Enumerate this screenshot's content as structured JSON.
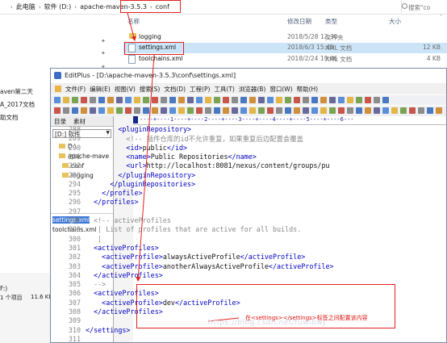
{
  "explorer": {
    "breadcrumb": [
      "此电脑",
      "软件 (D:)",
      "apache-maven-3.5.3",
      "conf"
    ],
    "search_placeholder": "搜索\"co",
    "columns": {
      "name": "名称",
      "date": "修改日期",
      "type": "类型",
      "size": "大小"
    },
    "files": [
      {
        "name": "logging",
        "date": "2018/5/28 12:30",
        "type": "文件夹",
        "size": ""
      },
      {
        "name": "settings.xml",
        "date": "2018/6/3 15:45",
        "type": "XML 文档",
        "size": "12 KB"
      },
      {
        "name": "toolchains.xml",
        "date": "2018/2/24 19:46",
        "type": "XML 文档",
        "size": "4 KB"
      }
    ],
    "left_nav": [
      "aven第二天",
      "A_2017文档",
      "助文档"
    ],
    "status": {
      "drive": "F:)",
      "count": "1 个项目",
      "size": "11.6 KB"
    }
  },
  "editplus": {
    "title": "EditPlus - [D:\\apache-maven-3.5.3\\conf\\settings.xml]",
    "menu": [
      "文件(F)",
      "编辑(E)",
      "视图(V)",
      "搜索(S)",
      "文档(D)",
      "工程(P)",
      "工具(T)",
      "浏览器(B)",
      "窗口(W)",
      "帮助(H)"
    ],
    "tabs": [
      "目录",
      "素材"
    ],
    "drive": "[D:] 软件",
    "tree": [
      "D:\\",
      "apache-mave",
      "conf",
      "logging"
    ],
    "files": [
      "settings.xml",
      "toolchains.xml"
    ],
    "ruler": "----+----1----+----2----+----3----+----4----+----5----+----6---",
    "lines": [
      {
        "n": "288",
        "segs": [
          [
            "t",
            "        <pluginRepository>"
          ]
        ]
      },
      {
        "n": "289",
        "segs": [
          [
            "c",
            "          <!-- 插件仓库的id不允许重复，如果重复后边配置会覆盖"
          ]
        ]
      },
      {
        "n": "290",
        "segs": [
          [
            "t",
            "          <id>"
          ],
          [
            "x",
            "public"
          ],
          [
            "t",
            "</id>"
          ]
        ]
      },
      {
        "n": "291",
        "segs": [
          [
            "t",
            "          <name>"
          ],
          [
            "x",
            "Public Repositories"
          ],
          [
            "t",
            "</name>"
          ]
        ]
      },
      {
        "n": "292",
        "segs": [
          [
            "t",
            "          <url>"
          ],
          [
            "x",
            "http://localhost:8081/nexus/content/groups/pu"
          ]
        ]
      },
      {
        "n": "293",
        "segs": [
          [
            "t",
            "        </pluginRepository>"
          ]
        ]
      },
      {
        "n": "294",
        "segs": [
          [
            "t",
            "      </pluginRepositories>"
          ]
        ]
      },
      {
        "n": "295",
        "segs": [
          [
            "t",
            "    </profile>"
          ]
        ]
      },
      {
        "n": "296",
        "segs": [
          [
            "t",
            "  </profiles>"
          ]
        ]
      },
      {
        "n": "297",
        "segs": [
          [
            "x",
            ""
          ]
        ]
      },
      {
        "n": "298",
        "segs": [
          [
            "c",
            "  <!-- activeProfiles"
          ]
        ]
      },
      {
        "n": "299",
        "segs": [
          [
            "c",
            "   | List of profiles that are active for all builds."
          ]
        ]
      },
      {
        "n": "300",
        "segs": [
          [
            "c",
            "   |"
          ]
        ]
      },
      {
        "n": "301",
        "segs": [
          [
            "t",
            "  <activeProfiles>"
          ]
        ]
      },
      {
        "n": "302",
        "segs": [
          [
            "t",
            "    <activeProfile>"
          ],
          [
            "x",
            "alwaysActiveProfile"
          ],
          [
            "t",
            "</activeProfile>"
          ]
        ]
      },
      {
        "n": "303",
        "segs": [
          [
            "t",
            "    <activeProfile>"
          ],
          [
            "x",
            "anotherAlwaysActiveProfile"
          ],
          [
            "t",
            "</activeProfile>"
          ]
        ]
      },
      {
        "n": "304",
        "segs": [
          [
            "t",
            "  </activeProfiles>"
          ]
        ]
      },
      {
        "n": "305",
        "segs": [
          [
            "c",
            "  -->"
          ]
        ]
      },
      {
        "n": "306",
        "segs": [
          [
            "t",
            "  <activeProfiles>"
          ]
        ]
      },
      {
        "n": "307",
        "segs": [
          [
            "t",
            "    <activeProfile>"
          ],
          [
            "x",
            "dev"
          ],
          [
            "t",
            "</activeProfile>"
          ]
        ]
      },
      {
        "n": "308",
        "segs": [
          [
            "t",
            "  </activeProfiles>"
          ]
        ]
      },
      {
        "n": "309",
        "segs": [
          [
            "x",
            ""
          ]
        ]
      },
      {
        "n": "310",
        "segs": [
          [
            "t",
            "</settings>"
          ]
        ]
      },
      {
        "n": "311",
        "segs": [
          [
            "x",
            ""
          ]
        ]
      }
    ],
    "annotation": "在<settings></settings>标签之间配置该内容",
    "watermark": "https://blog.csdn.net/fuwibwj"
  },
  "colors": {
    "tag": "#0000c0",
    "comment": "#8a8a8a",
    "annotation": "#e02020",
    "selection": "#3b77d6"
  }
}
